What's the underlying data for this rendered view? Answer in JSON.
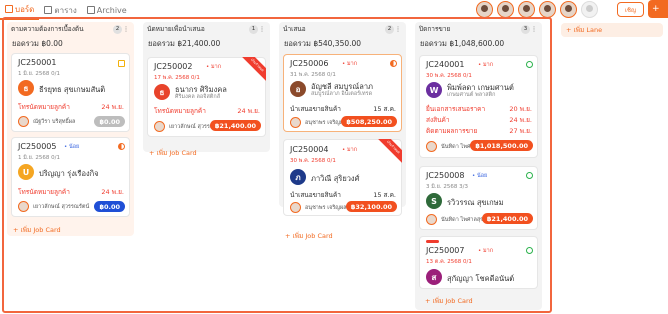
{
  "tabs": [
    {
      "label": "บอร์ด",
      "icon": "board-icon"
    },
    {
      "label": "ตาราง",
      "icon": "table-icon"
    },
    {
      "label": "Archive",
      "icon": "archive-icon"
    }
  ],
  "share_label": "เชิญ",
  "add_label": "+",
  "add_lane": "+ เพิ่ม Lane",
  "add_card": "+ เพิ่ม Job Card",
  "columns": [
    {
      "title": "ตามความต้องการเบื้องต้น",
      "count": "2",
      "total": "ยอดรวม ฿0.00"
    },
    {
      "title": "นัดหมายเพื่อนำเสนอ",
      "count": "1",
      "total": "ยอดรวม ฿21,400.00"
    },
    {
      "title": "นำเสนอ",
      "count": "2",
      "total": "ยอดรวม ฿540,350.00"
    },
    {
      "title": "ปิดการขาย",
      "count": "3",
      "total": "ยอดรวม ฿1,048,600.00"
    }
  ],
  "cards": {
    "c1": {
      "id": "JC250001",
      "meta": "1 มิ.ย. 2568  0/1",
      "initial": "ธ",
      "name": "ธีรยุทธ สุขเกษมสันติ",
      "f1": "โทรนัดหมายลูกค้า",
      "f1d": "24 พ.ย.",
      "owner": "ณัฐวีรา บริสุทธิ์ผล",
      "amount": "฿0.00"
    },
    "c2": {
      "id": "JC250005",
      "tag": "• น้อย",
      "meta": "1 มิ.ย. 2568  0/1",
      "initial": "U",
      "name": "ปริญญา รุ่งเรืองกิจ",
      "f1": "โทรนัดหมายลูกค้า",
      "f1d": "24 พ.ย.",
      "owner": "เยาวลักษณ์ สุวรรณรัตน์",
      "amount": "฿0.00"
    },
    "c3": {
      "id": "JC250002",
      "tag": "• มาก",
      "meta": "17 พ.ค. 2568  0/1",
      "initial": "ธ",
      "name": "ธนากร ศิริมงคล",
      "sub": "ศิริมงคล ลอจิสติกส์",
      "f1": "โทรนัดหมายลูกค้า",
      "f1d": "24 พ.ย.",
      "owner": "เยาวลักษณ์ สุวรรณรัตน์",
      "amount": "฿21,400.00",
      "ribbon": "เกินกำหนด"
    },
    "c4": {
      "id": "JC250006",
      "tag": "• มาก",
      "meta": "31 พ.ค. 2568  0/1",
      "initial": "อ",
      "name": "อัญชลี สมบูรณ์ลาภ",
      "sub": "สมบูรณ์ลาภ อินเตอร์เทรด",
      "f1": "นำเสนอขายสินค้า",
      "f1d": "15 ส.ค.",
      "owner": "อนุชาพร เจริญผล",
      "amount": "฿508,250.00"
    },
    "c5": {
      "id": "JC250004",
      "tag": "• มาก",
      "meta": "30 พ.ค. 2568  0/1",
      "initial": "ภ",
      "name": "ภาวิณี สุริยวงศ์",
      "f1": "นำเสนอขายสินค้า",
      "f1d": "15 ส.ค.",
      "owner": "อนุชาพร เจริญผล",
      "amount": "฿32,100.00",
      "ribbon": "เกินกำหนด"
    },
    "c6": {
      "id": "JC240001",
      "tag": "• มาก",
      "meta": "30 พ.ค. 2568  0/1",
      "initial": "W",
      "name": "พิมพ์ลดา เกษมศานต์",
      "sub": "เกษมศานต์ พลาสติก",
      "f1": "ยื่นเอกสารเสนอราคา",
      "f1d": "20 พ.ย.",
      "f2": "ส่งสินค้า",
      "f2d": "24 พ.ย.",
      "f3": "ติดตามผลการขาย",
      "f3d": "27 พ.ย.",
      "owner": "นันทิดา ไพศาลสุข",
      "amount": "฿1,018,500.00"
    },
    "c7": {
      "id": "JC250008",
      "tag": "• น้อย",
      "meta": "3 มิ.ย. 2568  3/3",
      "initial": "S",
      "name": "รวิวรรณ สุขเกษม",
      "owner": "นันทิดา ไพศาลสุข",
      "amount": "฿21,400.00"
    },
    "c8": {
      "id": "JC250007",
      "tag": "• มาก",
      "meta": "13 ต.ค. 2568  0/1",
      "initial": "ส",
      "name": "สุกัญญา โชคดีอนันต์"
    }
  }
}
